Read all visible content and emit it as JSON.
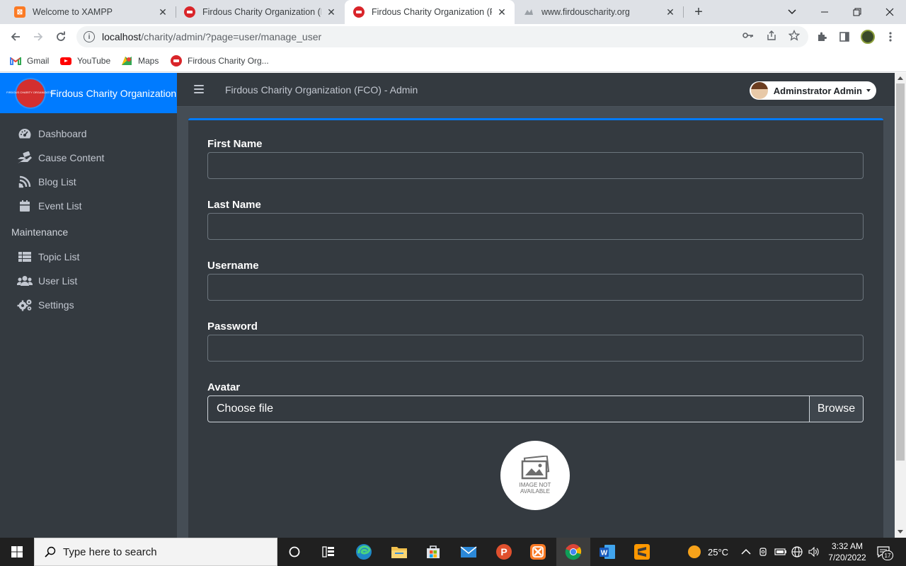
{
  "browser": {
    "tabs": [
      {
        "label": "Welcome to XAMPP",
        "icon": "xampp-icon"
      },
      {
        "label": "Firdous Charity Organization (FCO",
        "icon": "fco-icon"
      },
      {
        "label": "Firdous Charity Organization (FCO",
        "icon": "fco-icon"
      },
      {
        "label": "www.firdouscharity.org",
        "icon": "globe-icon"
      }
    ],
    "url_host": "localhost",
    "url_path": "/charity/admin/?page=user/manage_user",
    "bookmarks": [
      {
        "label": "Gmail"
      },
      {
        "label": "YouTube"
      },
      {
        "label": "Maps"
      },
      {
        "label": "Firdous Charity Org..."
      }
    ]
  },
  "sidebar": {
    "brand": "Firdous Charity Organization (FCO)",
    "logo_text": "FIRDOUS CHARITY ORGANIZATION",
    "items": [
      {
        "label": "Dashboard",
        "icon": "tachometer-icon"
      },
      {
        "label": "Cause Content",
        "icon": "hand-holding-icon"
      },
      {
        "label": "Blog List",
        "icon": "blog-icon"
      },
      {
        "label": "Event List",
        "icon": "calendar-icon"
      }
    ],
    "maintenance_header": "Maintenance",
    "maintenance_items": [
      {
        "label": "Topic List",
        "icon": "list-icon"
      },
      {
        "label": "User List",
        "icon": "users-icon"
      },
      {
        "label": "Settings",
        "icon": "cogs-icon"
      }
    ]
  },
  "topnav": {
    "title": "Firdous Charity Organization (FCO) - Admin",
    "user": "Adminstrator Admin"
  },
  "form": {
    "first_name_label": "First Name",
    "first_name_value": "",
    "last_name_label": "Last Name",
    "last_name_value": "",
    "username_label": "Username",
    "username_value": "",
    "password_label": "Password",
    "password_value": "",
    "avatar_label": "Avatar",
    "file_placeholder": "Choose file",
    "browse_label": "Browse",
    "image_placeholder_line1": "IMAGE NOT",
    "image_placeholder_line2": "AVAILABLE"
  },
  "taskbar": {
    "search_placeholder": "Type here to search",
    "temperature": "25°C",
    "time": "3:32 AM",
    "date": "7/20/2022",
    "notifications": "17"
  },
  "colors": {
    "accent": "#007bff",
    "sidebar_bg": "#343a40",
    "content_bg": "#454d55"
  }
}
